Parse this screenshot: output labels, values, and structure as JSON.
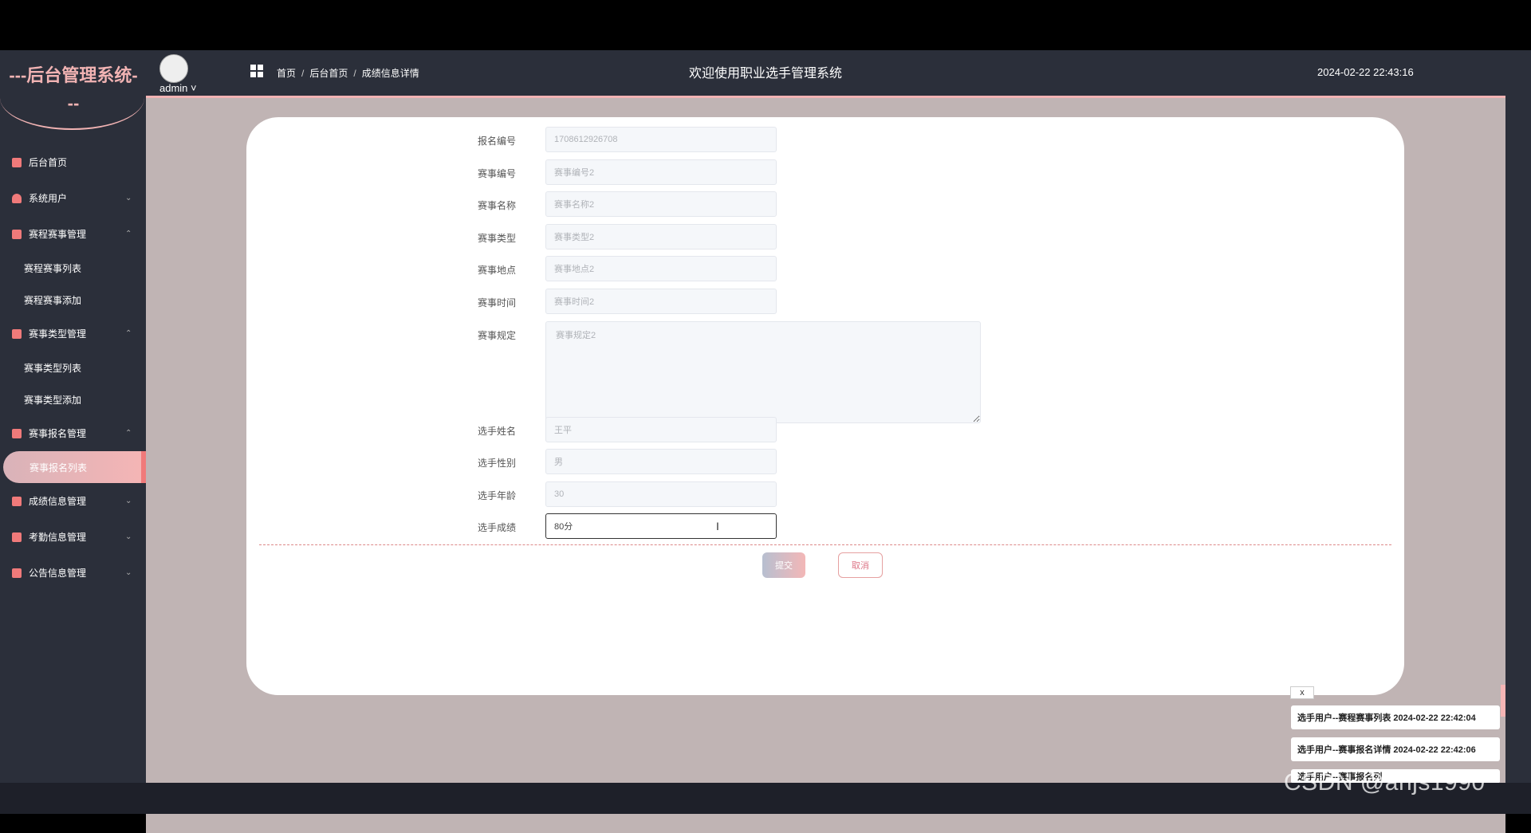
{
  "sidebar": {
    "logo": "---后台管理系统---",
    "items": [
      {
        "label": "后台首页",
        "icon": "monitor-icon",
        "chevron": ""
      },
      {
        "label": "系统用户",
        "icon": "user-icon",
        "chevron": "⌄"
      },
      {
        "label": "赛程赛事管理",
        "icon": "chart-icon",
        "chevron": "⌃",
        "children": [
          "赛程赛事列表",
          "赛程赛事添加"
        ]
      },
      {
        "label": "赛事类型管理",
        "icon": "chart-icon",
        "chevron": "⌃",
        "children": [
          "赛事类型列表",
          "赛事类型添加"
        ]
      },
      {
        "label": "赛事报名管理",
        "icon": "chart-icon",
        "chevron": "⌃",
        "children": [
          "赛事报名列表"
        ]
      },
      {
        "label": "成绩信息管理",
        "icon": "chart-icon",
        "chevron": "⌄"
      },
      {
        "label": "考勤信息管理",
        "icon": "chart-icon",
        "chevron": "⌄"
      },
      {
        "label": "公告信息管理",
        "icon": "chart-icon",
        "chevron": "⌄"
      }
    ]
  },
  "header": {
    "user": "admin",
    "breadcrumb": [
      "首页",
      "后台首页",
      "成绩信息详情"
    ],
    "title": "欢迎使用职业选手管理系统",
    "datetime": "2024-02-22 22:43:16"
  },
  "form": {
    "fields": [
      {
        "label": "报名编号",
        "value": "1708612926708"
      },
      {
        "label": "赛事编号",
        "value": "赛事编号2"
      },
      {
        "label": "赛事名称",
        "value": "赛事名称2"
      },
      {
        "label": "赛事类型",
        "value": "赛事类型2"
      },
      {
        "label": "赛事地点",
        "value": "赛事地点2"
      },
      {
        "label": "赛事时间",
        "value": "赛事时间2"
      },
      {
        "label": "赛事规定",
        "value": "赛事规定2"
      },
      {
        "label": "选手姓名",
        "value": "王平"
      },
      {
        "label": "选手性别",
        "value": "男"
      },
      {
        "label": "选手年龄",
        "value": "30"
      },
      {
        "label": "选手成绩",
        "value": "80分"
      }
    ],
    "submit": "提交",
    "cancel": "取消"
  },
  "notifications": {
    "close": "x",
    "items": [
      "选手用户--赛程赛事列表 2024-02-22 22:42:04",
      "选手用户--赛事报名详情 2024-02-22 22:42:06",
      "选手用户--赛事报名列"
    ]
  },
  "watermark": "CSDN @ahjs1990"
}
